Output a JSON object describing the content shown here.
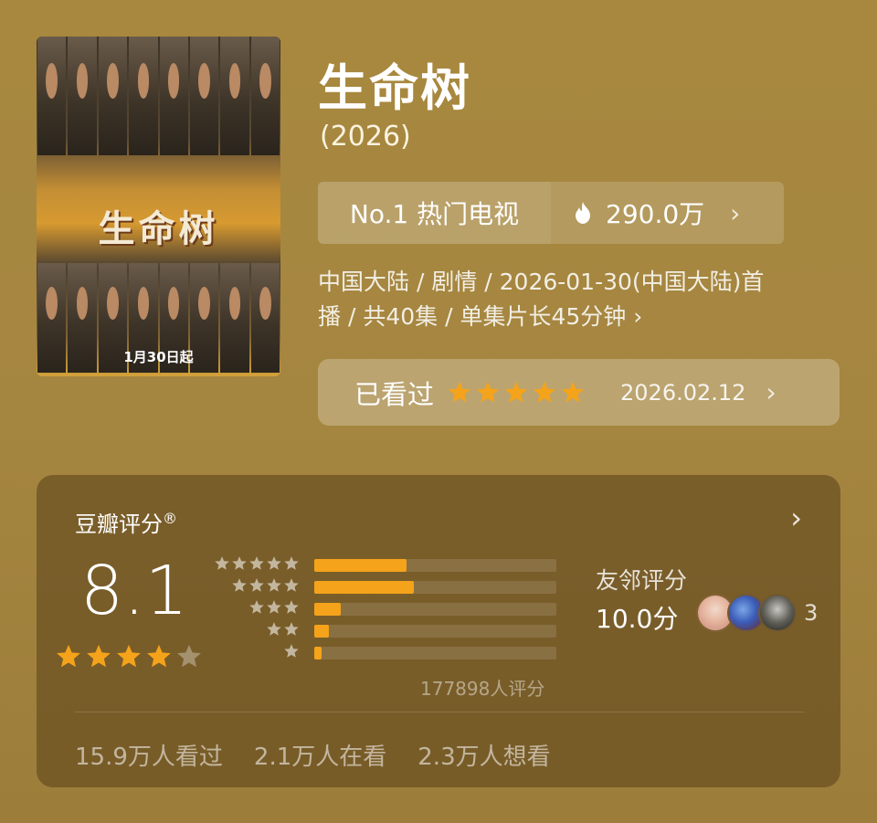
{
  "poster": {
    "title_text": "生命树",
    "date_text": "1月30日起"
  },
  "title": "生命树",
  "year": "(2026)",
  "rank": {
    "label": "No.1 热门电视",
    "heat_value": "290.0万",
    "heat_icon": "flame-icon"
  },
  "meta": {
    "line1": "中国大陆 / 剧情 / 2026-01-30(中国大陆)首",
    "line2": "播 / 共40集 / 单集片长45分钟 ›"
  },
  "watched": {
    "label": "已看过",
    "stars": 5,
    "date": "2026.02.12"
  },
  "douban": {
    "title": "豆瓣评分",
    "score": "8.1",
    "stars_filled": 4,
    "stars_total": 5,
    "distribution": [
      {
        "stars": 5,
        "fraction": 0.38
      },
      {
        "stars": 4,
        "fraction": 0.41
      },
      {
        "stars": 3,
        "fraction": 0.11
      },
      {
        "stars": 2,
        "fraction": 0.06
      },
      {
        "stars": 1,
        "fraction": 0.03
      }
    ],
    "vote_count": "177898人评分",
    "friends_label": "友邻评分",
    "friends_score": "10.0分",
    "friends_count": "3",
    "watched_count": "15.9万人看过",
    "watching_count": "2.1万人在看",
    "want_count": "2.3万人想看"
  },
  "colors": {
    "star_gold": "#f5a31a",
    "background": "#a8883f"
  }
}
